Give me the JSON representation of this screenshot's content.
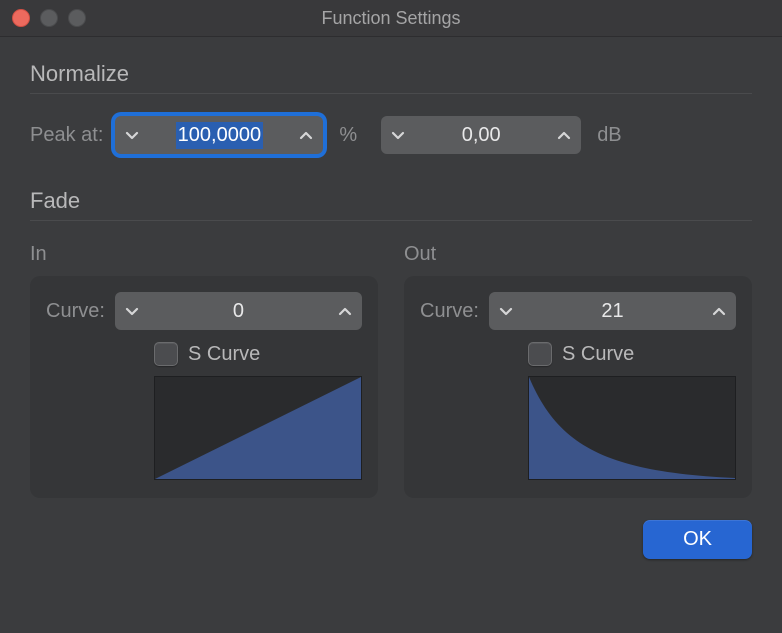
{
  "window": {
    "title": "Function Settings"
  },
  "normalize": {
    "header": "Normalize",
    "peak_label": "Peak at:",
    "percent_value": "100,0000",
    "percent_unit": "%",
    "db_value": "0,00",
    "db_unit": "dB"
  },
  "fade": {
    "header": "Fade",
    "in": {
      "label": "In",
      "curve_label": "Curve:",
      "curve_value": "0",
      "scurve_label": "S Curve",
      "scurve_checked": false
    },
    "out": {
      "label": "Out",
      "curve_label": "Curve:",
      "curve_value": "21",
      "scurve_label": "S Curve",
      "scurve_checked": false
    }
  },
  "footer": {
    "ok_label": "OK"
  },
  "colors": {
    "accent": "#2766d2",
    "graph_fill": "#3c5489",
    "graph_bg": "#2a2b2d"
  }
}
